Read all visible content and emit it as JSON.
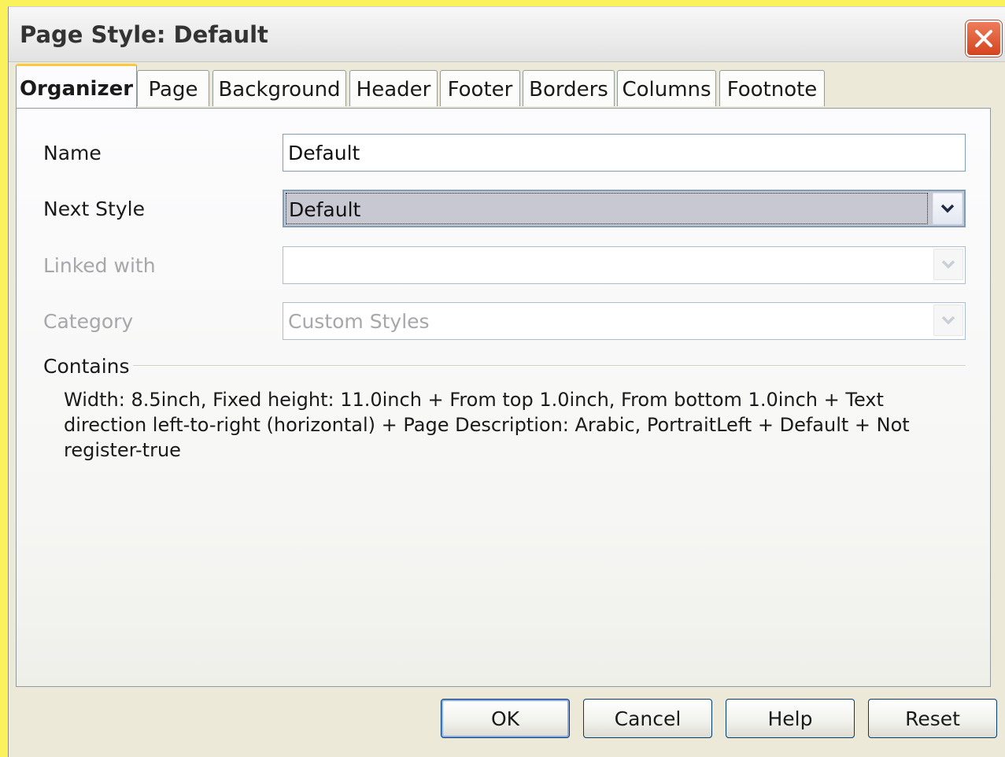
{
  "window": {
    "title": "Page Style: Default"
  },
  "tabs": [
    {
      "label": "Organizer",
      "active": true
    },
    {
      "label": "Page",
      "active": false
    },
    {
      "label": "Background",
      "active": false
    },
    {
      "label": "Header",
      "active": false
    },
    {
      "label": "Footer",
      "active": false
    },
    {
      "label": "Borders",
      "active": false
    },
    {
      "label": "Columns",
      "active": false
    },
    {
      "label": "Footnote",
      "active": false
    }
  ],
  "organizer": {
    "name_label": "Name",
    "name_value": "Default",
    "next_style_label": "Next Style",
    "next_style_value": "Default",
    "linked_with_label": "Linked with",
    "linked_with_value": "",
    "category_label": "Category",
    "category_value": "Custom Styles",
    "contains_label": "Contains",
    "contains_text": "Width: 8.5inch, Fixed height: 11.0inch + From top 1.0inch, From bottom 1.0inch + Text direction left-to-right (horizontal) + Page Description: Arabic, PortraitLeft + Default + Not register-true"
  },
  "buttons": {
    "ok": "OK",
    "cancel": "Cancel",
    "help": "Help",
    "reset": "Reset"
  }
}
